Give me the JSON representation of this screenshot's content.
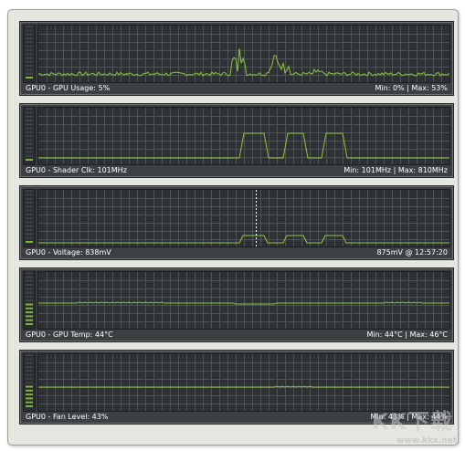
{
  "accent_color": "#8ec63f",
  "panels": [
    {
      "label": "GPU0 - GPU Usage: 5%",
      "stats": "Min: 0% | Max: 53%",
      "meter_level": 0.05
    },
    {
      "label": "GPU0 - Shader Clk: 101MHz",
      "stats": "Min: 101MHz | Max: 810MHz",
      "meter_level": 0.05
    },
    {
      "label": "GPU0 - Voltage: 838mV",
      "stats": "875mV @ 12:57:20",
      "meter_level": 0.05
    },
    {
      "label": "GPU0 - GPU Temp: 44°C",
      "stats": "Min: 44°C | Max: 46°C",
      "meter_level": 0.44
    },
    {
      "label": "GPU0 - Fan Level: 43%",
      "stats": "Min: 43% | Max: 44%",
      "meter_level": 0.43
    }
  ],
  "watermark": {
    "brand": "KK下载",
    "site": "www.kkx.net"
  }
}
